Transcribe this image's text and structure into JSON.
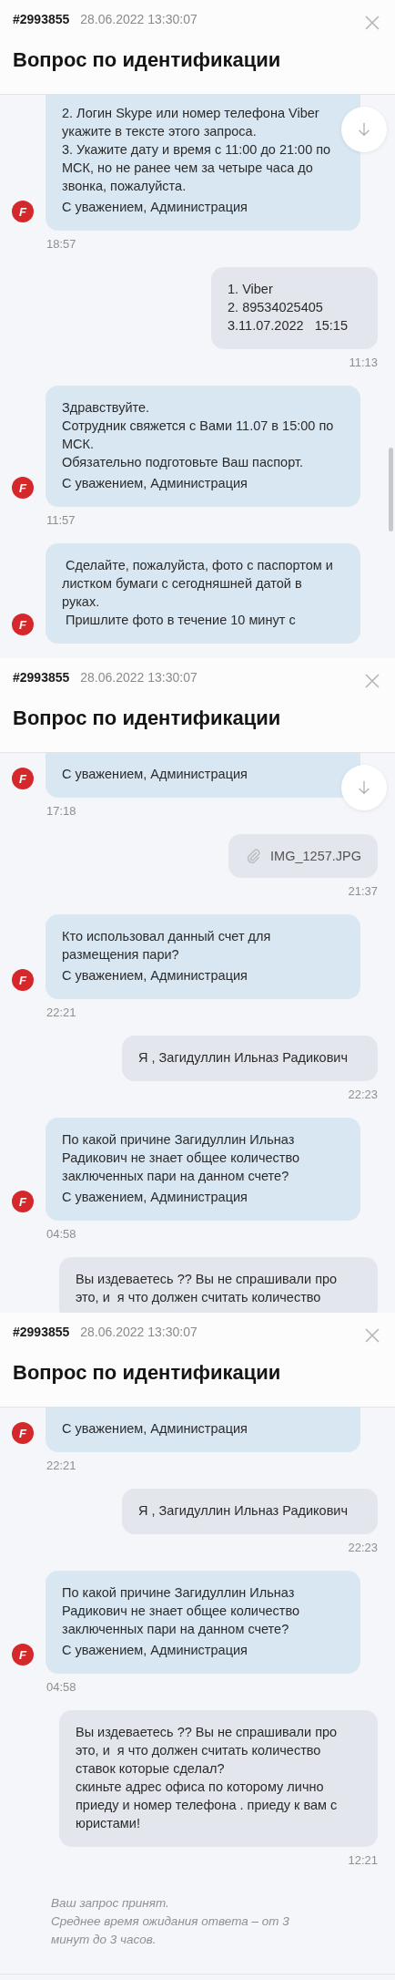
{
  "screens": [
    {
      "ticket": "#2993855",
      "date": "28.06.2022 13:30:07",
      "title": "Вопрос по идентификации",
      "scroll_down_button": true,
      "scrollbar": true,
      "messages": [
        {
          "kind": "admin",
          "avatar": "F",
          "paragraphs": [
            "2. Логин Skype или номер телефона Viber укажите в тексте этого запроса.",
            "3. Укажите дату и время с 11:00 до 21:00 по МСК, но не ранее чем за четыре часа до звонка, пожалуйста."
          ],
          "signature": "С уважением, Администрация",
          "time": "18:57"
        },
        {
          "kind": "user",
          "paragraphs": [
            "1. Viber",
            "2. 89534025405",
            "3.11.07.2022   15:15"
          ],
          "time": "11:13"
        },
        {
          "kind": "admin",
          "avatar": "F",
          "paragraphs": [
            "Здравствуйте.",
            "Сотрудник свяжется с Вами 11.07 в 15:00 по МСК.",
            "Обязательно подготовьте Ваш паспорт."
          ],
          "signature": "С уважением, Администрация",
          "time": "11:57"
        },
        {
          "kind": "admin",
          "avatar": "F",
          "paragraphs": [
            " Сделайте, пожалуйста, фото с паспортом и листком бумаги с сегодняшней датой в руках.",
            " Пришлите фото в течение 10 минут с"
          ]
        }
      ]
    },
    {
      "ticket": "#2993855",
      "date": "28.06.2022 13:30:07",
      "title": "Вопрос по идентификации",
      "scroll_down_button": true,
      "scrollbar": false,
      "messages": [
        {
          "kind": "admin",
          "avatar": "F",
          "signature": "С уважением, Администрация",
          "time": "17:18"
        },
        {
          "kind": "file",
          "filename": "IMG_1257.JPG",
          "time": "21:37"
        },
        {
          "kind": "admin",
          "avatar": "F",
          "paragraphs": [
            "Кто использовал данный счет для размещения пари?"
          ],
          "signature": "С уважением, Администрация",
          "time": "22:21"
        },
        {
          "kind": "user",
          "paragraphs": [
            "Я , Загидуллин Ильназ Радикович"
          ],
          "time": "22:23"
        },
        {
          "kind": "admin",
          "avatar": "F",
          "paragraphs": [
            "По какой причине Загидуллин Ильназ Радикович не знает общее количество заключенных пари на данном счете?"
          ],
          "signature": "С уважением, Администрация",
          "time": "04:58"
        },
        {
          "kind": "user",
          "paragraphs": [
            "Вы издеваетесь ?? Вы не спрашивали про это, и  я что должен считать количество"
          ]
        }
      ]
    },
    {
      "ticket": "#2993855",
      "date": "28.06.2022 13:30:07",
      "title": "Вопрос по идентификации",
      "scroll_down_button": false,
      "scrollbar": false,
      "messages": [
        {
          "kind": "admin",
          "avatar": "F",
          "signature": "С уважением, Администрация",
          "time": "22:21"
        },
        {
          "kind": "user",
          "paragraphs": [
            "Я , Загидуллин Ильназ Радикович"
          ],
          "time": "22:23"
        },
        {
          "kind": "admin",
          "avatar": "F",
          "paragraphs": [
            "По какой причине Загидуллин Ильназ Радикович не знает общее количество заключенных пари на данном счете?"
          ],
          "signature": "С уважением, Администрация",
          "time": "04:58"
        },
        {
          "kind": "user",
          "paragraphs": [
            "Вы издеваетесь ?? Вы не спрашивали про это, и  я что должен считать количество ставок которые сделал?",
            "скиньте адрес офиса по которому лично приеду и номер телефона . приеду к вам с юристами!"
          ],
          "time": "12:21"
        }
      ],
      "status_note": [
        "Ваш запрос принят.",
        "Среднее время ожидания ответа – от 3 минут до 3 часов."
      ]
    }
  ]
}
